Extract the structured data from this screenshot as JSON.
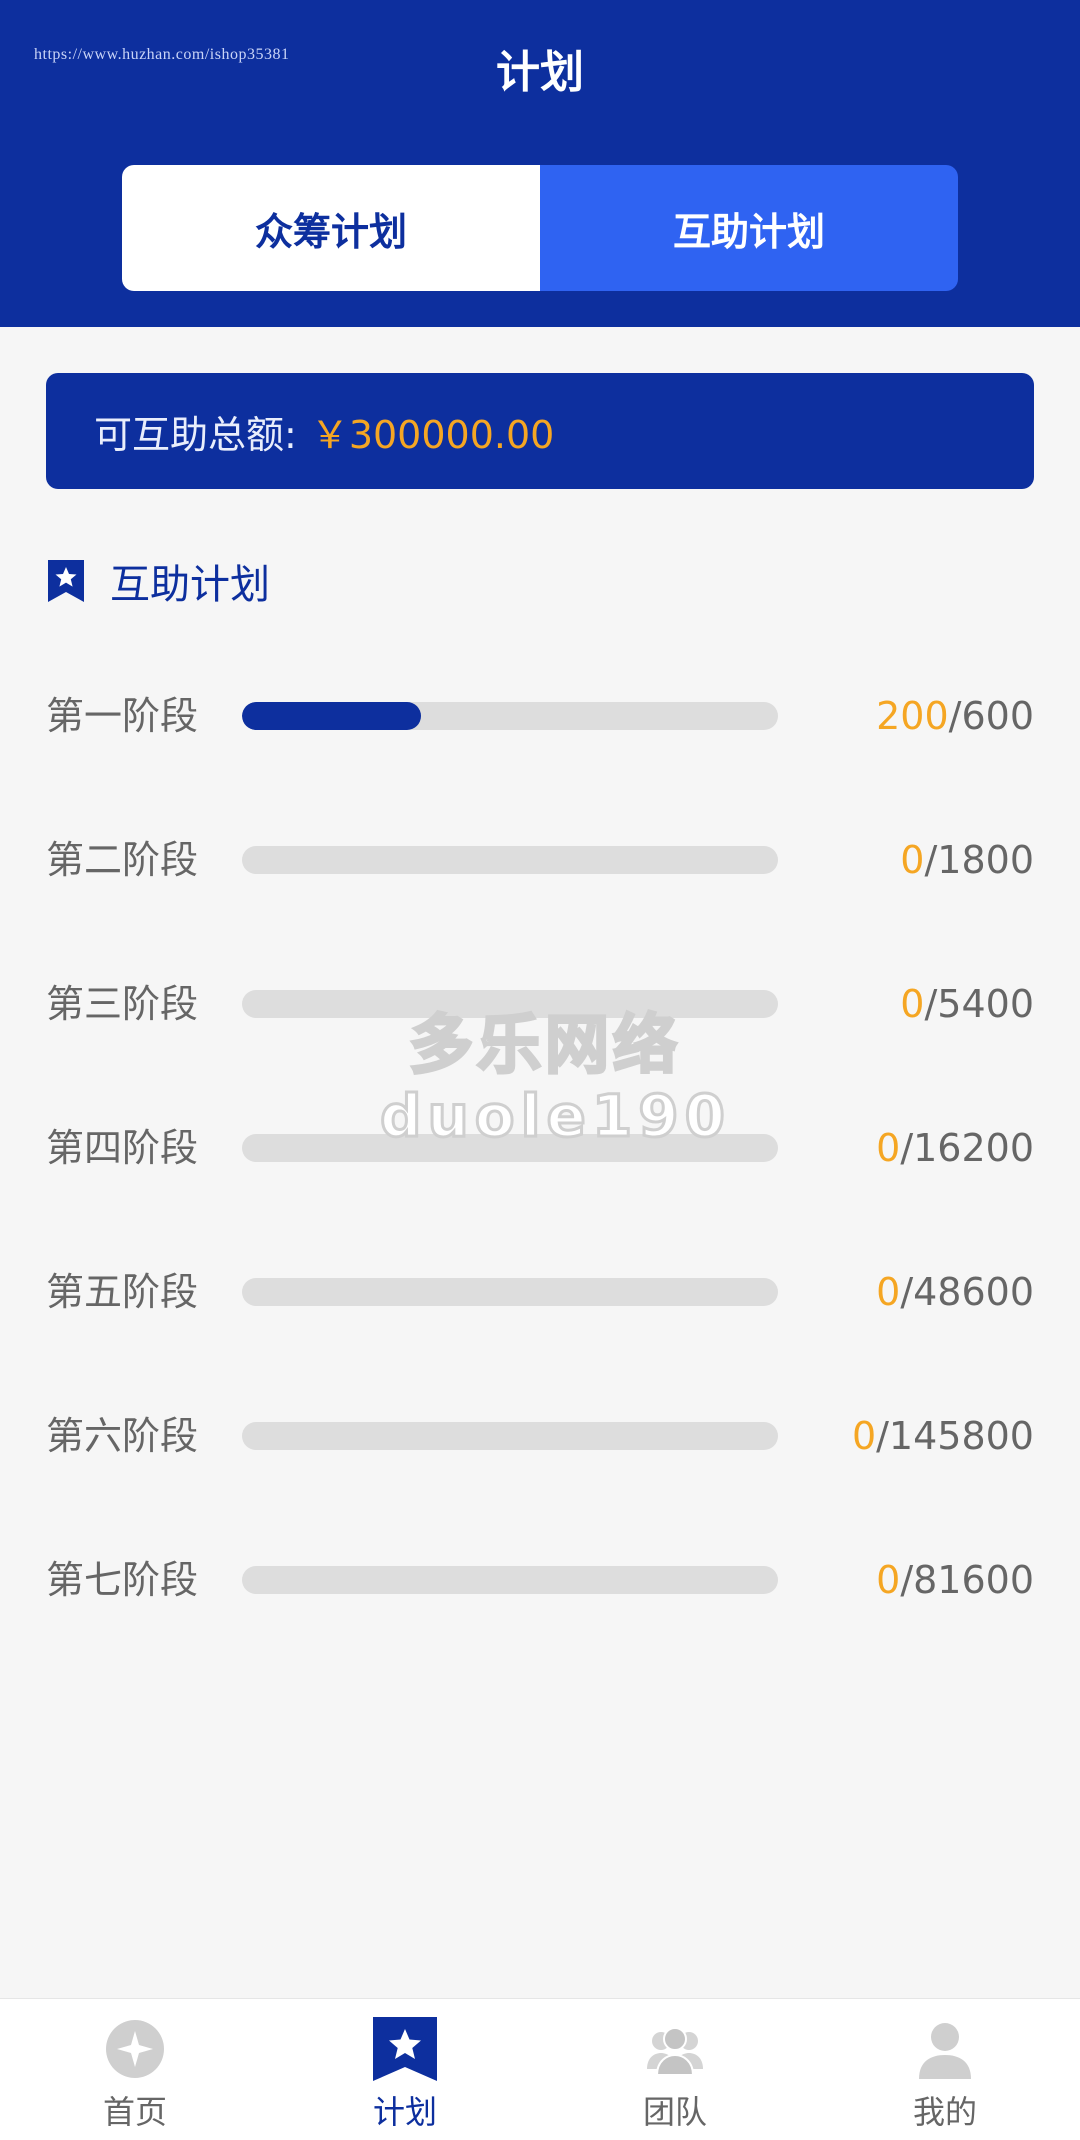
{
  "header": {
    "watermark_url": "https://www.huzhan.com/ishop35381",
    "title": "计划"
  },
  "tabs": [
    {
      "label": "众筹计划",
      "active": false
    },
    {
      "label": "互助计划",
      "active": true
    }
  ],
  "total": {
    "label": "可互助总额:",
    "value": "￥300000.00"
  },
  "section": {
    "icon": "star-bookmark-icon",
    "title": "互助计划"
  },
  "stages": [
    {
      "name": "第一阶段",
      "current": "200",
      "total": "/600",
      "progress": 0.3333
    },
    {
      "name": "第二阶段",
      "current": "0",
      "total": "/1800",
      "progress": 0
    },
    {
      "name": "第三阶段",
      "current": "0",
      "total": "/5400",
      "progress": 0
    },
    {
      "name": "第四阶段",
      "current": "0",
      "total": "/16200",
      "progress": 0
    },
    {
      "name": "第五阶段",
      "current": "0",
      "total": "/48600",
      "progress": 0
    },
    {
      "name": "第六阶段",
      "current": "0",
      "total": "/145800",
      "progress": 0
    },
    {
      "name": "第七阶段",
      "current": "0",
      "total": "/81600",
      "progress": 0
    }
  ],
  "watermark": {
    "line1": "多乐网络",
    "line2": "duole190"
  },
  "tabbar": [
    {
      "label": "首页",
      "icon": "home-icon",
      "active": false
    },
    {
      "label": "计划",
      "icon": "star-bookmark-icon",
      "active": true
    },
    {
      "label": "团队",
      "icon": "team-icon",
      "active": false
    },
    {
      "label": "我的",
      "icon": "user-icon",
      "active": false
    }
  ],
  "colors": {
    "primary": "#0d2f9e",
    "accent_tab": "#2f63f2",
    "highlight": "#f5a623",
    "track": "#dddddd",
    "background": "#f6f6f6"
  }
}
